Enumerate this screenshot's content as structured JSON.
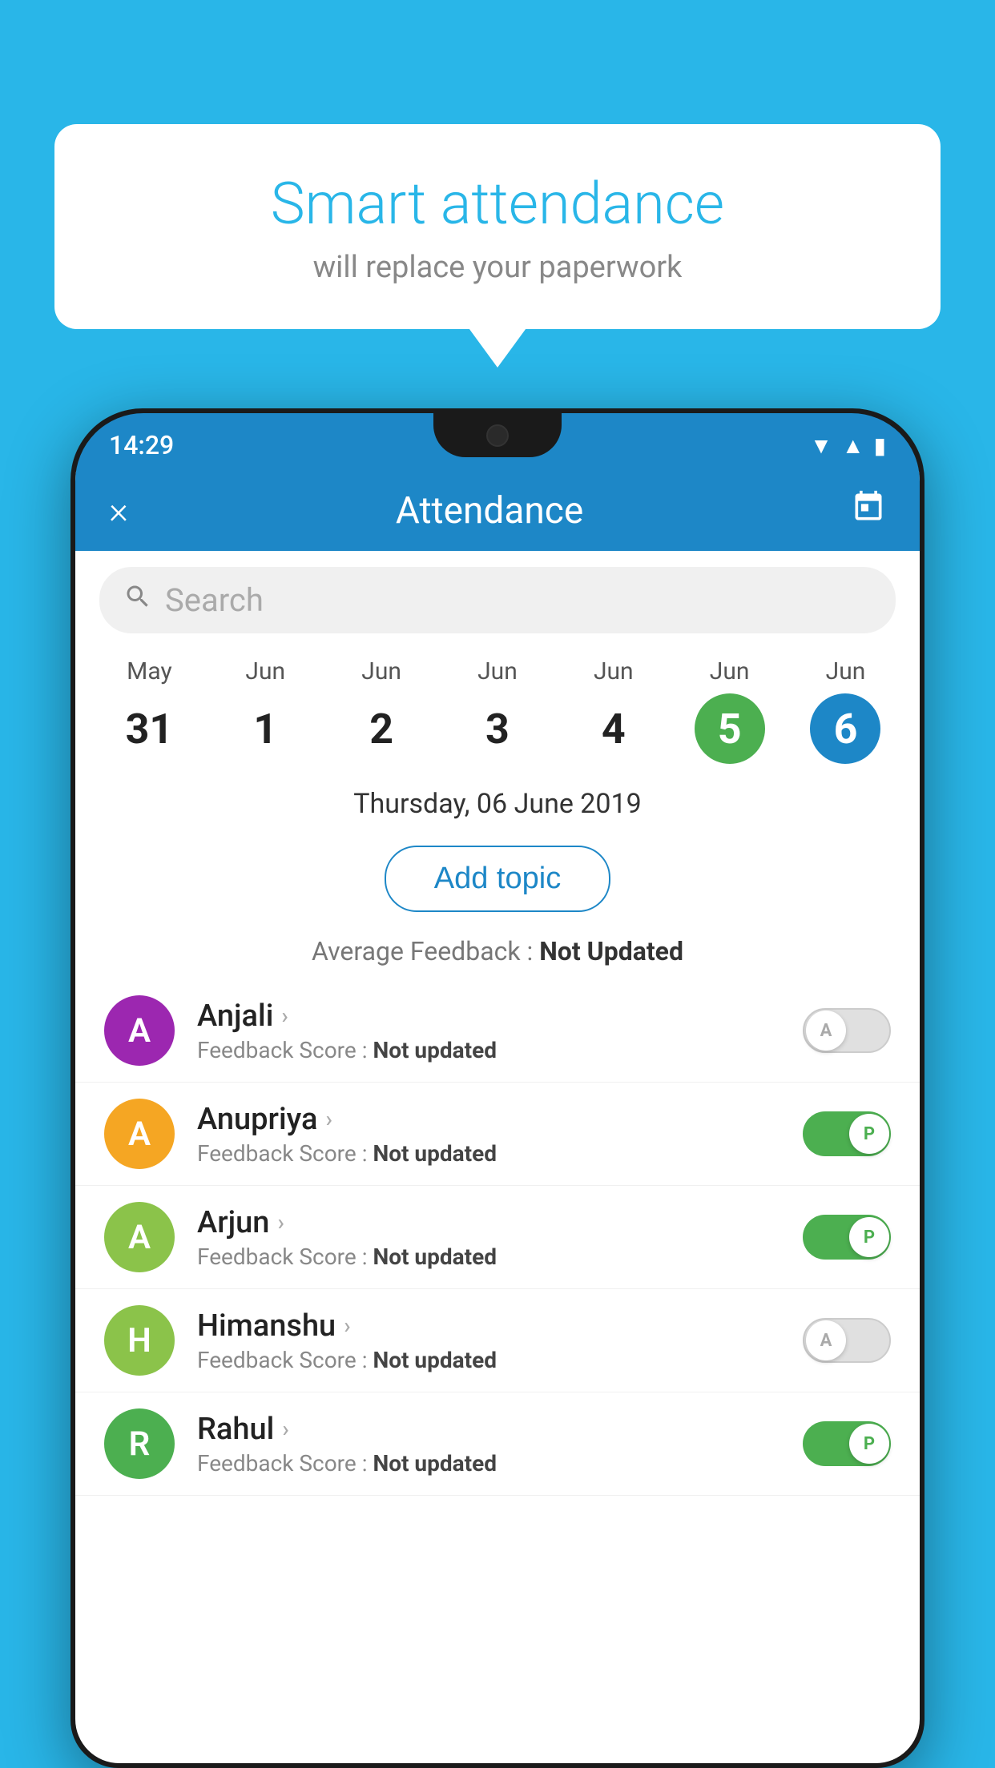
{
  "background_color": "#29b6e8",
  "speech_bubble": {
    "title": "Smart attendance",
    "subtitle": "will replace your paperwork"
  },
  "status_bar": {
    "time": "14:29",
    "icons": [
      "wifi",
      "signal",
      "battery"
    ]
  },
  "header": {
    "title": "Attendance",
    "close_label": "×",
    "calendar_icon": "📅"
  },
  "search": {
    "placeholder": "Search"
  },
  "calendar": {
    "days": [
      {
        "month": "May",
        "date": "31",
        "state": "normal"
      },
      {
        "month": "Jun",
        "date": "1",
        "state": "normal"
      },
      {
        "month": "Jun",
        "date": "2",
        "state": "normal"
      },
      {
        "month": "Jun",
        "date": "3",
        "state": "normal"
      },
      {
        "month": "Jun",
        "date": "4",
        "state": "normal"
      },
      {
        "month": "Jun",
        "date": "5",
        "state": "today"
      },
      {
        "month": "Jun",
        "date": "6",
        "state": "selected"
      }
    ]
  },
  "selected_date": "Thursday, 06 June 2019",
  "add_topic_label": "Add topic",
  "average_feedback_label": "Average Feedback :",
  "average_feedback_value": "Not Updated",
  "students": [
    {
      "name": "Anjali",
      "initial": "A",
      "avatar_color": "#9c27b0",
      "feedback_label": "Feedback Score :",
      "feedback_value": "Not updated",
      "toggle_state": "off",
      "toggle_label": "A"
    },
    {
      "name": "Anupriya",
      "initial": "A",
      "avatar_color": "#f5a623",
      "feedback_label": "Feedback Score :",
      "feedback_value": "Not updated",
      "toggle_state": "on",
      "toggle_label": "P"
    },
    {
      "name": "Arjun",
      "initial": "A",
      "avatar_color": "#8bc34a",
      "feedback_label": "Feedback Score :",
      "feedback_value": "Not updated",
      "toggle_state": "on",
      "toggle_label": "P"
    },
    {
      "name": "Himanshu",
      "initial": "H",
      "avatar_color": "#8bc34a",
      "feedback_label": "Feedback Score :",
      "feedback_value": "Not updated",
      "toggle_state": "off",
      "toggle_label": "A"
    },
    {
      "name": "Rahul",
      "initial": "R",
      "avatar_color": "#4caf50",
      "feedback_label": "Feedback Score :",
      "feedback_value": "Not updated",
      "toggle_state": "on",
      "toggle_label": "P"
    }
  ]
}
